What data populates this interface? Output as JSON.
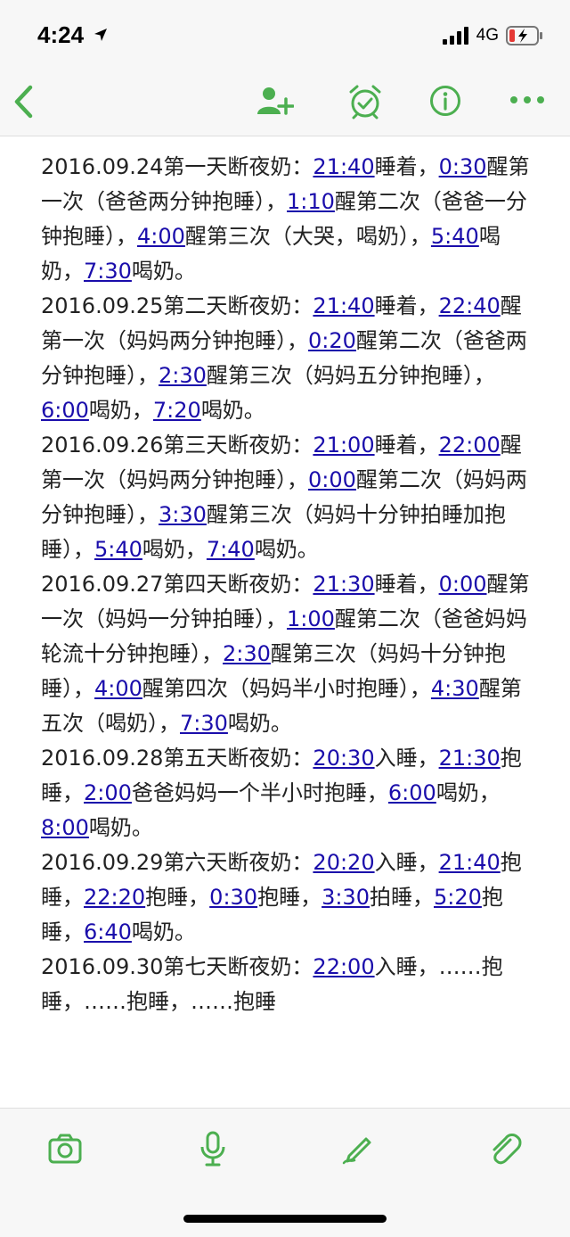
{
  "status": {
    "time": "4:24",
    "network": "4G",
    "location_icon": "location-arrow-icon",
    "signal_icon": "signal-bars-icon",
    "battery_icon": "battery-charging-icon"
  },
  "toolbar": {
    "accent": "#4caf50",
    "icons": [
      "back-chevron-icon",
      "add-contact-icon",
      "alarm-clock-icon",
      "info-icon",
      "more-dots-icon"
    ]
  },
  "note": {
    "link_color": "#1a0dab",
    "entries": [
      {
        "parts": [
          "2016.09.24第一天断夜奶：",
          {
            "t": "21:40"
          },
          "睡着，",
          {
            "t": "0:30"
          },
          "醒第一次（爸爸两分钟抱睡），",
          {
            "t": "1:10"
          },
          "醒第二次（爸爸一分钟抱睡），",
          {
            "t": "4:00"
          },
          "醒第三次（大哭，喝奶），",
          {
            "t": "5:40"
          },
          "喝奶，",
          {
            "t": "7:30"
          },
          "喝奶。"
        ]
      },
      {
        "parts": [
          "2016.09.25第二天断夜奶：",
          {
            "t": "21:40"
          },
          "睡着，",
          {
            "t": "22:40"
          },
          "醒第一次（妈妈两分钟抱睡），",
          {
            "t": "0:20"
          },
          "醒第二次（爸爸两分钟抱睡），",
          {
            "t": "2:30"
          },
          "醒第三次（妈妈五分钟抱睡），",
          {
            "t": "6:00"
          },
          "喝奶，",
          {
            "t": "7:20"
          },
          "喝奶。"
        ]
      },
      {
        "parts": [
          "2016.09.26第三天断夜奶：",
          {
            "t": "21:00"
          },
          "睡着，",
          {
            "t": "22:00"
          },
          "醒第一次（妈妈两分钟抱睡），",
          {
            "t": "0:00"
          },
          "醒第二次（妈妈两分钟抱睡），",
          {
            "t": "3:30"
          },
          "醒第三次（妈妈十分钟拍睡加抱睡），",
          {
            "t": "5:40"
          },
          "喝奶，",
          {
            "t": "7:40"
          },
          "喝奶。"
        ]
      },
      {
        "parts": [
          "2016.09.27第四天断夜奶：",
          {
            "t": "21:30"
          },
          "睡着，",
          {
            "t": "0:00"
          },
          "醒第一次（妈妈一分钟拍睡），",
          {
            "t": "1:00"
          },
          "醒第二次（爸爸妈妈轮流十分钟抱睡），",
          {
            "t": "2:30"
          },
          "醒第三次（妈妈十分钟抱睡），",
          {
            "t": "4:00"
          },
          "醒第四次（妈妈半小时抱睡），",
          {
            "t": "4:30"
          },
          "醒第五次（喝奶），",
          {
            "t": "7:30"
          },
          "喝奶。"
        ]
      },
      {
        "parts": [
          "2016.09.28第五天断夜奶：",
          {
            "t": "20:30"
          },
          "入睡，",
          {
            "t": "21:30"
          },
          "抱睡，",
          {
            "t": "2:00"
          },
          "爸爸妈妈一个半小时抱睡，",
          {
            "t": "6:00"
          },
          "喝奶，",
          {
            "t": "8:00"
          },
          "喝奶。"
        ]
      },
      {
        "parts": [
          "2016.09.29第六天断夜奶：",
          {
            "t": "20:20"
          },
          "入睡，",
          {
            "t": "21:40"
          },
          "抱睡，",
          {
            "t": "22:20"
          },
          "抱睡，",
          {
            "t": "0:30"
          },
          "抱睡，",
          {
            "t": "3:30"
          },
          "拍睡，",
          {
            "t": "5:20"
          },
          "抱睡，",
          {
            "t": "6:40"
          },
          "喝奶。"
        ]
      },
      {
        "parts": [
          "2016.09.30第七天断夜奶：",
          {
            "t": "22:00"
          },
          "入睡，……抱睡，……抱睡，……抱睡"
        ]
      }
    ]
  },
  "bottom_toolbar": {
    "icons": [
      "camera-icon",
      "voice-note-icon",
      "pen-icon",
      "attachment-icon"
    ]
  }
}
